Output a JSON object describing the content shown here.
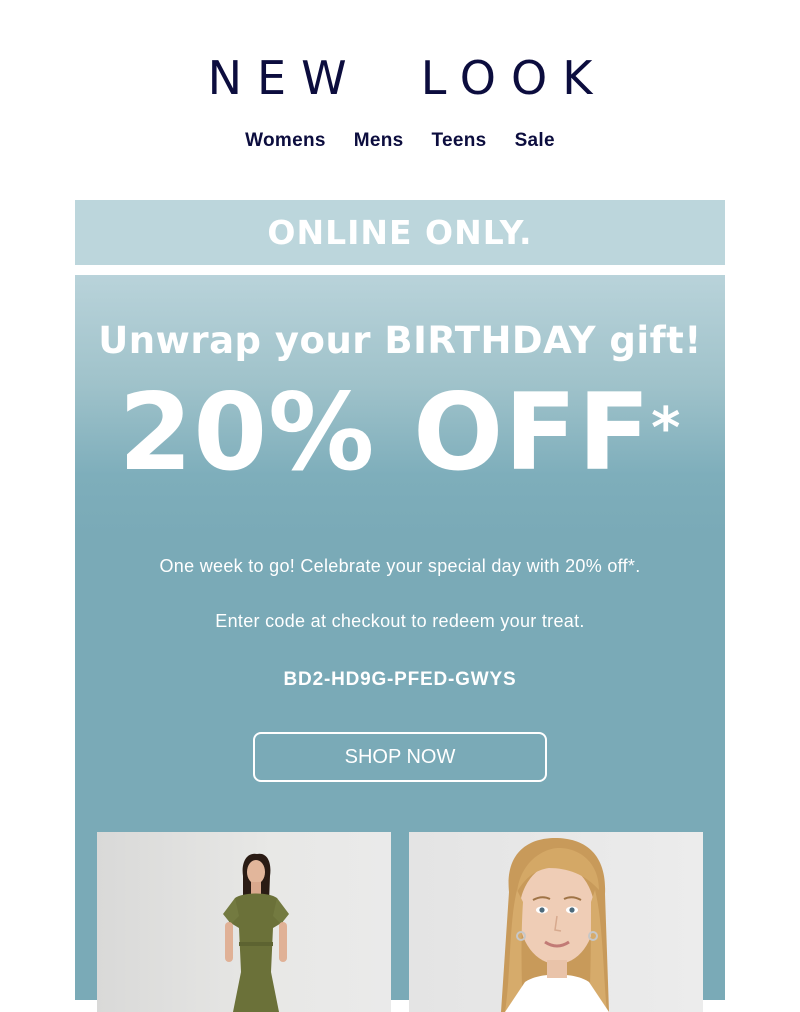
{
  "header": {
    "logo_text": "NEW  LOOK",
    "nav": [
      "Womens",
      "Mens",
      "Teens",
      "Sale"
    ]
  },
  "banner": {
    "top_text": "ONLINE ONLY."
  },
  "hero": {
    "subtitle": "Unwrap your BIRTHDAY gift!",
    "headline": "20% OFF",
    "headline_mark": "*",
    "body_line1": "One week to go! Celebrate your special day with 20% off*.",
    "body_line2": "Enter code at checkout to redeem your treat.",
    "code": "BD2-HD9G-PFED-GWYS",
    "cta": "SHOP NOW"
  },
  "colors": {
    "navy": "#0c0d3e",
    "banner_light": "#bcd6dc",
    "hero_teal": "#7aaab7",
    "dress_olive": "#6b7139"
  }
}
